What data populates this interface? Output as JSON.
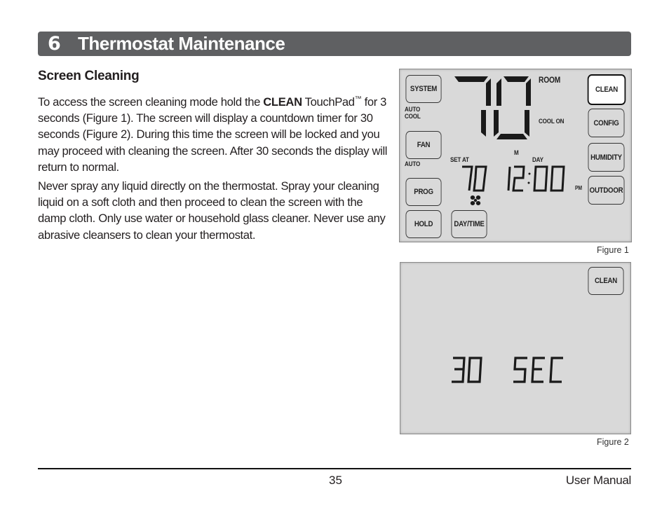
{
  "header": {
    "chapter_number": "6",
    "chapter_title": "Thermostat Maintenance"
  },
  "section": {
    "title": "Screen Cleaning",
    "paragraph1": {
      "before_bold": "To access the screen cleaning mode hold the ",
      "bold": "CLEAN",
      "after_bold": " TouchPad",
      "trademark": "™",
      "rest": "for 3 seconds (Figure 1). The screen will display a countdown timer for 30 seconds (Figure 2). During this time the screen will be locked and you may proceed with cleaning the screen. After 30 seconds the display will return to normal."
    },
    "paragraph2": "Never spray any liquid directly on the thermostat. Spray your cleaning liquid on a soft cloth and then proceed to clean the screen with the damp cloth. Only use water or household glass cleaner. Never use any abrasive cleansers to clean your thermostat."
  },
  "figure1": {
    "caption": "Figure 1",
    "room_temp": "70",
    "room_label": "ROOM",
    "cool_on_label": "COOL ON",
    "system_mode_line1": "AUTO",
    "system_mode_line2": "COOL",
    "fan_mode": "AUTO",
    "set_at_label": "SET AT",
    "set_temp": "70",
    "day_letter": "M",
    "day_label": "DAY",
    "time": "12:00",
    "ampm": "PM",
    "fan_icon": "fan-icon",
    "buttons_left": [
      "SYSTEM",
      "FAN",
      "PROG",
      "HOLD"
    ],
    "button_daytime": "DAY/TIME",
    "buttons_right": [
      "CLEAN",
      "CONFIG",
      "HUMIDITY",
      "OUTDOOR"
    ],
    "active_button": "CLEAN"
  },
  "figure2": {
    "caption": "Figure 2",
    "clean_button": "CLEAN",
    "countdown_value": "30",
    "countdown_unit": "SEC"
  },
  "footer": {
    "page_number": "35",
    "title": "User Manual"
  }
}
